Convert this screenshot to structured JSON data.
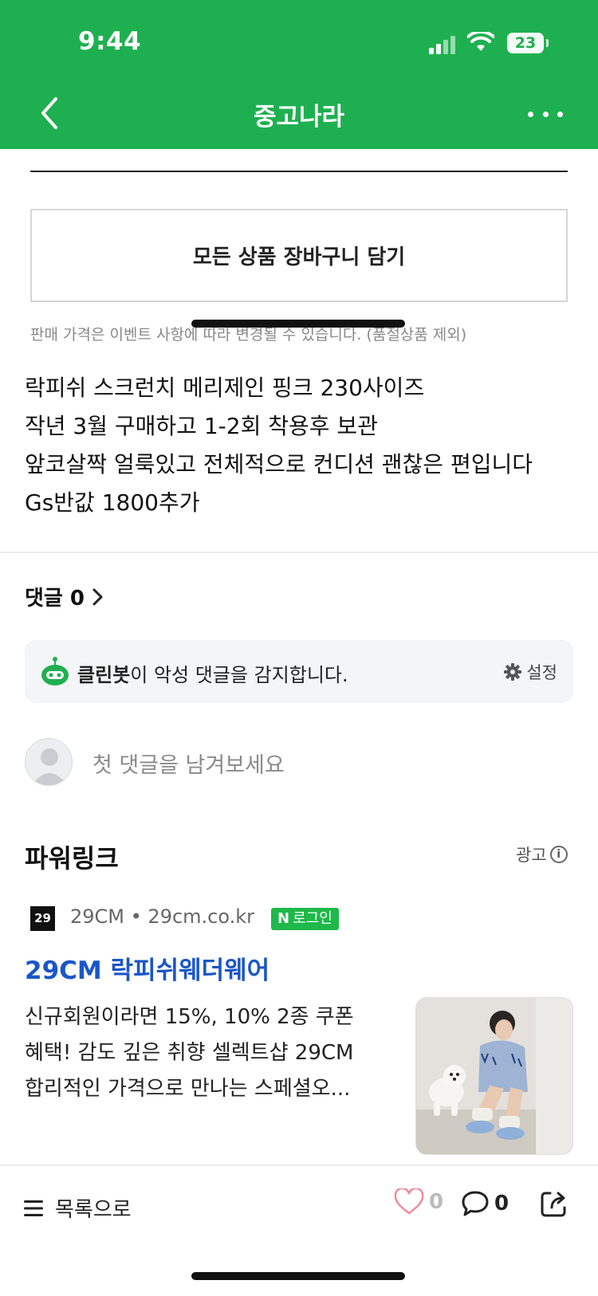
{
  "status": {
    "time": "9:44",
    "battery": "23"
  },
  "header": {
    "title": "중고나라"
  },
  "cart": {
    "label": "모든 상품 장바구니 담기"
  },
  "price_note": "판매 가격은 이벤트 사항에 따라 변경될 수 있습니다. (품절상품 제외)",
  "description": [
    "락피쉬 스크런치 메리제인 핑크 230사이즈",
    "작년 3월 구매하고 1-2회 착용후 보관",
    "앞코살짝 얼룩있고 전체적으로 컨디션 괜찮은 편입니다",
    "Gs반값 1800추가"
  ],
  "comments": {
    "header": "댓글 0",
    "cleanbot_name": "클린봇",
    "cleanbot_text": "이 악성 댓글을 감지합니다.",
    "settings_label": "설정",
    "input_placeholder": "첫 댓글을 남겨보세요"
  },
  "powerlink": {
    "title": "파워링크",
    "ad_label": "광고",
    "info_glyph": "i",
    "logo_text": "29",
    "source": "29CM • 29cm.co.kr",
    "naver_n": "N",
    "login_badge": "로그인",
    "headline": "29CM 락피쉬웨더웨어",
    "desc": [
      "신규회원이라면 15%, 10% 2종 쿠폰",
      "혜택! 감도 깊은 취향 셀렉트샵 29CM",
      "합리적인 가격으로 만나는 스페셜오..."
    ]
  },
  "bottom": {
    "list_label": "목록으로",
    "like_count": "0",
    "comment_count": "0"
  },
  "colors": {
    "brand_green": "#1eb050",
    "link_blue": "#1a56c8",
    "naver_green": "#1fb84a"
  },
  "icons": [
    "back-arrow-icon",
    "more-icon",
    "chevron-right-icon",
    "cleanbot-icon",
    "gear-icon",
    "default-avatar-icon",
    "info-icon",
    "menu-icon",
    "heart-icon",
    "comment-bubble-icon",
    "share-icon"
  ]
}
